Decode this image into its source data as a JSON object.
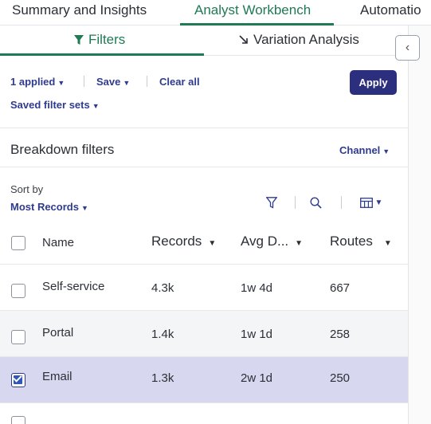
{
  "top_tabs": [
    {
      "label": "Summary and Insights"
    },
    {
      "label": "Analyst Workbench"
    },
    {
      "label": "Automatio"
    }
  ],
  "sub_tabs": {
    "filters": "Filters",
    "variation": "Variation Analysis"
  },
  "actions": {
    "applied": "1 applied",
    "save": "Save",
    "clear_all": "Clear all",
    "saved_filter_sets": "Saved filter sets",
    "apply": "Apply"
  },
  "breakdown": {
    "title": "Breakdown filters",
    "channel": "Channel"
  },
  "sort": {
    "label": "Sort by",
    "value": "Most Records"
  },
  "table": {
    "columns": [
      "Name",
      "Records",
      "Avg D...",
      "Routes"
    ],
    "rows": [
      {
        "name": "Self-service",
        "records": "4.3k",
        "avg": "1w 4d",
        "routes": "667",
        "checked": false
      },
      {
        "name": "Portal",
        "records": "1.4k",
        "avg": "1w 1d",
        "routes": "258",
        "checked": false
      },
      {
        "name": "Email",
        "records": "1.3k",
        "avg": "2w 1d",
        "routes": "250",
        "checked": true
      }
    ]
  },
  "colors": {
    "accent_green": "#1f7a55",
    "accent_navy": "#2b2f7e",
    "link": "#2f3b8f",
    "selected_row": "#d7d8ef"
  },
  "icons": [
    "filter-icon",
    "variation-arrow-icon",
    "chevron-left-icon",
    "funnel-icon",
    "search-icon",
    "columns-icon"
  ]
}
